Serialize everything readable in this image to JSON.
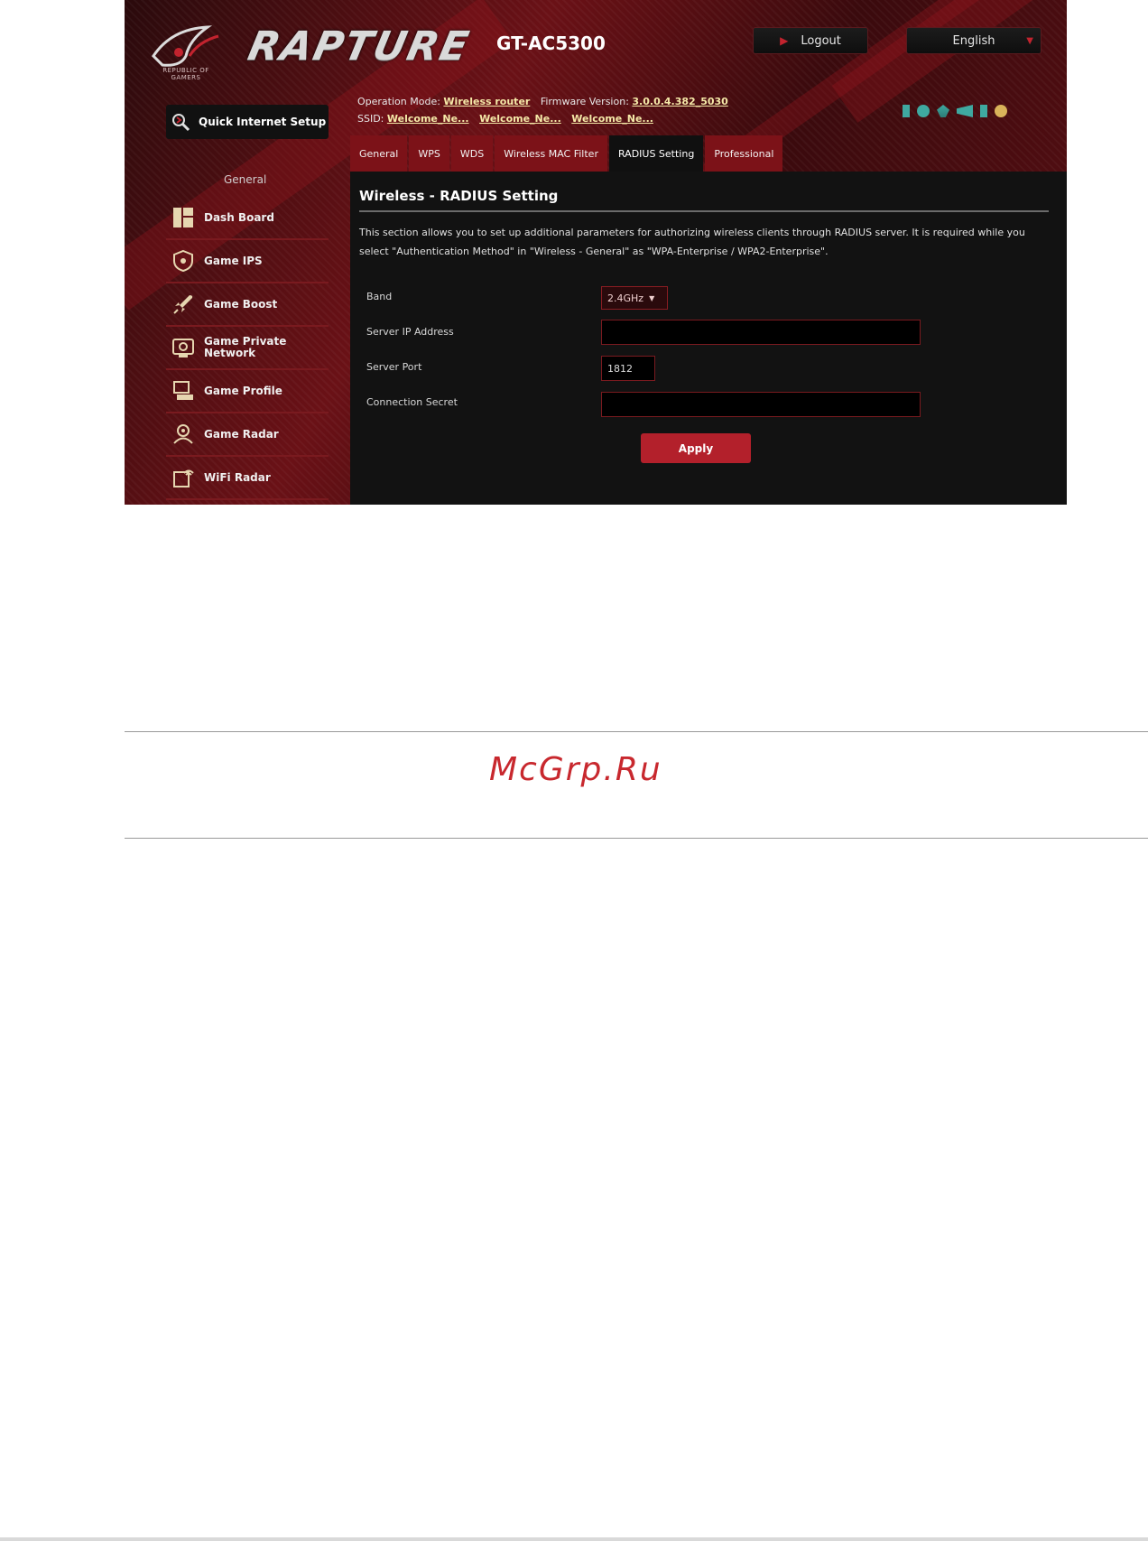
{
  "header": {
    "brand_title": "RAPTURE",
    "model": "GT-AC5300",
    "logo_caption": "REPUBLIC OF GAMERS",
    "logout_label": "Logout",
    "language_label": "English"
  },
  "sidebar": {
    "quick_setup_label": "Quick Internet Setup",
    "section_label": "General",
    "items": [
      {
        "label": "Dash Board",
        "icon": "dashboard-icon"
      },
      {
        "label": "Game IPS",
        "icon": "shield-icon"
      },
      {
        "label": "Game Boost",
        "icon": "rocket-icon"
      },
      {
        "label": "Game Private Network",
        "icon": "network-icon"
      },
      {
        "label": "Game Profile",
        "icon": "profile-icon"
      },
      {
        "label": "Game Radar",
        "icon": "radar-icon"
      },
      {
        "label": "WiFi Radar",
        "icon": "wifi-radar-icon"
      }
    ]
  },
  "info": {
    "op_mode_label": "Operation Mode:",
    "op_mode_value": "Wireless router",
    "firmware_label": "Firmware Version:",
    "firmware_value": "3.0.0.4.382_5030",
    "ssid_label": "SSID:",
    "ssid_values": [
      "Welcome_Ne...",
      "Welcome_Ne...",
      "Welcome_Ne..."
    ]
  },
  "tabs": [
    "General",
    "WPS",
    "WDS",
    "Wireless MAC Filter",
    "RADIUS Setting",
    "Professional"
  ],
  "active_tab": "RADIUS Setting",
  "panel": {
    "title": "Wireless - RADIUS Setting",
    "description": "This section allows you to set up additional parameters for authorizing wireless clients through RADIUS server. It is required while you select \"Authentication Method\" in \"Wireless - General\" as \"WPA-Enterprise / WPA2-Enterprise\".",
    "band_label": "Band",
    "band_value": "2.4GHz",
    "server_ip_label": "Server IP Address",
    "server_ip_value": "",
    "server_port_label": "Server Port",
    "server_port_value": "1812",
    "secret_label": "Connection Secret",
    "secret_value": "",
    "apply_label": "Apply"
  },
  "watermark": "McGrp.Ru",
  "colors": {
    "accent_red": "#b3202b",
    "tab_red": "#7c1218",
    "panel_bg": "#121212",
    "watermark": "#c8282e"
  }
}
